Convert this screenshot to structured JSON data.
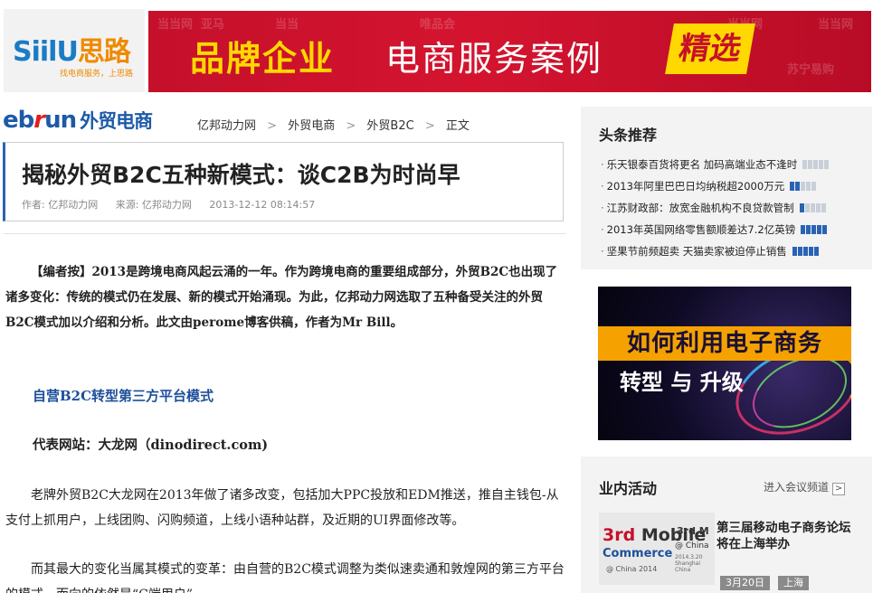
{
  "top": {
    "logo_en": "SiilU",
    "logo_cn": "思路",
    "logo_sub": "找电商服务，上思路",
    "banner_main": "品牌企业",
    "banner_rest": "电商服务案例",
    "banner_tag": "精选",
    "banner_bg": [
      "当当网",
      "亚马",
      "当当",
      "唯品会",
      "苏宁易购",
      "当当网",
      "当当网"
    ]
  },
  "header": {
    "brand_e": "eb",
    "brand_r": "r",
    "brand_u": "un",
    "brand_cn": "外贸电商",
    "breadcrumb": [
      "亿邦动力网",
      "外贸电商",
      "外贸B2C",
      "正文"
    ],
    "sep": ">"
  },
  "article": {
    "title": "揭秘外贸B2C五种新模式：谈C2B为时尚早",
    "author": "作者: 亿邦动力网",
    "source": "来源: 亿邦动力网",
    "date": "2013-12-12 08:14:57",
    "intro": "【编者按】2013是跨境电商风起云涌的一年。作为跨境电商的重要组成部分，外贸B2C也出现了诸多变化：传统的模式仍在发展、新的模式开始涌现。为此，亿邦动力网选取了五种备受关注的外贸B2C模式加以介绍和分析。此文由perome博客供稿，作者为Mr Bill。",
    "heading1": "自营B2C转型第三方平台模式",
    "heading2": "代表网站：大龙网（dinodirect.com)",
    "para1": "老牌外贸B2C大龙网在2013年做了诸多改变，包括加大PPC投放和EDM推送，推自主钱包-从支付上抓用户，上线团购、闪购频道，上线小语种站群，及近期的UI界面修改等。",
    "para2": "而其最大的变化当属其模式的变革：由自营的B2C模式调整为类似速卖通和敦煌网的第三方平台的模式，而向的依然是“C端用户”"
  },
  "sidebar": {
    "headlines_title": "头条推荐",
    "headlines": [
      {
        "text": "乐天银泰百货将更名 加码高端业态不逢时",
        "level": 0
      },
      {
        "text": "2013年阿里巴巴日均纳税超2000万元",
        "level": 2
      },
      {
        "text": "江苏财政部：放宽金融机构不良贷款管制",
        "level": 1
      },
      {
        "text": "2013年英国网络零售额顺差达7.2亿英镑",
        "level": 5
      },
      {
        "text": "坚果节前频超卖 天猫卖家被迫停止销售",
        "level": 5
      }
    ],
    "ad_title": "如何利用电子商务",
    "ad_sub": "转型 与 升级",
    "activity_title": "业内活动",
    "activity_link": "进入会议频道",
    "activity_arrow": ">",
    "activity_img": {
      "l1a": "3rd ",
      "l1b": "Mobile",
      "l2": "Commerce",
      "l3": "@ China 2014",
      "r1": "3rd M",
      "r2": "@ China",
      "r3": "2014.3.20 Shanghai China"
    },
    "activity_text": "第三届移动电子商务论坛将在上海举办",
    "activity_date": "3月20日",
    "activity_city": "上海"
  }
}
